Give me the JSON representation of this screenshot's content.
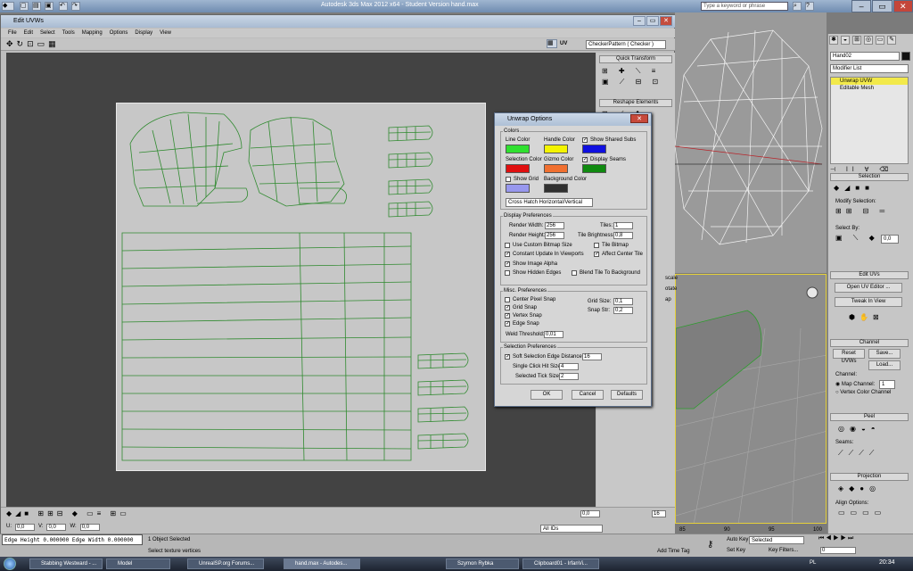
{
  "app": {
    "title": "Autodesk 3ds Max  2012 x64  -  Student Version   hand.max",
    "search_placeholder": "Type a keyword or phrase",
    "colors": {
      "uv_wire": "#2f8a2f",
      "titlebar": "#7f9cc0",
      "dialog_bg": "#d6d6d6",
      "accent_yellow": "#e5d03a"
    }
  },
  "uvw_window": {
    "title": "Edit UVWs",
    "menu": [
      "File",
      "Edit",
      "Select",
      "Tools",
      "Mapping",
      "Options",
      "Display",
      "View"
    ],
    "uv_label": "UV",
    "texture_dropdown": "CheckerPattern  ( Checker )",
    "quick_transform": "Quick Transform",
    "reshape_elements": "Reshape Elements",
    "side_fragments": [
      "scale",
      "otate",
      "ap"
    ],
    "bottom": {
      "u_label": "U:",
      "u_value": "0,0",
      "v_label": "V:",
      "v_value": "0,0",
      "w_label": "W:",
      "w_value": "0,0",
      "zoom_value": "0,0",
      "snap_value": "16",
      "ids_select": "All IDs"
    }
  },
  "dialog": {
    "title": "Unwrap Options",
    "colors_group": "Colors",
    "line_color": "Line Color",
    "line_color_hex": "#2fe02f",
    "handle_color": "Handle Color",
    "handle_color_hex": "#f4f400",
    "show_shared_subs": "Show Shared Subs",
    "shared_hex": "#1010e0",
    "selection_color": "Selection Color",
    "selection_hex": "#e01010",
    "gizmo_color": "Gizmo Color",
    "gizmo_hex": "#f07030",
    "display_seams": "Display Seams",
    "seams_hex": "#108a10",
    "show_grid": "Show Grid",
    "grid_hex": "#9898ee",
    "background_color": "Background Color",
    "background_hex": "#303030",
    "fill_mode": "Cross Hatch Horizontal/Vertical",
    "display_prefs": "Display Preferences",
    "render_width": "Render Width:",
    "render_width_val": "256",
    "render_height": "Render Height:",
    "render_height_val": "256",
    "tiles": "Tiles:",
    "tiles_val": "1",
    "tile_brightness": "Tile Brightness:",
    "tile_brightness_val": "0,8",
    "use_custom_bitmap": "Use Custom Bitmap Size",
    "tile_bitmap": "Tile Bitmap",
    "constant_update": "Constant Update In Viewports",
    "affect_center_tile": "Affect Center Tile",
    "show_image_alpha": "Show Image Alpha",
    "show_hidden_edges": "Show Hidden Edges",
    "blend_tile": "Blend Tile To Background",
    "misc_prefs": "Misc. Preferences",
    "center_pixel_snap": "Center Pixel Snap",
    "grid_size": "Grid Size:",
    "grid_size_val": "0,1",
    "grid_snap": "Grid Snap",
    "snap_str": "Snap Str:",
    "snap_str_val": "0,2",
    "vertex_snap": "Vertex Snap",
    "edge_snap": "Edge Snap",
    "weld_threshold": "Weld Threshold:",
    "weld_threshold_val": "0,01",
    "selection_prefs": "Selection Preferences",
    "soft_selection": "Soft Selection Edge Distance",
    "soft_selection_val": "16",
    "single_click": "Single Click Hit Size",
    "single_click_val": "4",
    "selected_tick": "Selected Tick Size",
    "selected_tick_val": "2",
    "ok": "OK",
    "cancel": "Cancel",
    "defaults": "Defaults"
  },
  "command_panel": {
    "object_name": "Hand02",
    "modifier_list": "Modifier List",
    "stack": [
      "Unwrap UVW",
      "Editable Mesh"
    ],
    "selection": "Selection",
    "modify_selection": "Modify Selection:",
    "select_by": "Select By:",
    "select_val": "0,0",
    "edit_uvs": "Edit UVs",
    "open_uv_editor": "Open UV Editor ...",
    "tweak_in_view": "Tweak In View",
    "channel": "Channel",
    "reset_uvws": "Reset UVWs",
    "save": "Save...",
    "load": "Load...",
    "channel_label": "Channel:",
    "map_channel": "Map Channel:",
    "map_channel_val": "1",
    "vertex_color_channel": "Vertex Color Channel",
    "peel": "Peel",
    "seams": "Seams:",
    "projection": "Projection",
    "align_options": "Align Options:"
  },
  "status": {
    "edge_readout": "Edge Height 0.000000 Edge Width 0.000000",
    "selection": "1 Object Selected",
    "prompt": "Select texture vertices",
    "add_time_tag": "Add Time Tag",
    "auto_key": "Auto Key",
    "set_key": "Set Key",
    "selected": "Selected",
    "key_filters": "Key Filters...",
    "ruler": [
      "85",
      "90",
      "95",
      "100"
    ],
    "frame": "0"
  },
  "taskbar": {
    "tasks": [
      "Stabbing Westward - ...",
      "Model",
      "UnrealSP.org Forums...",
      "hand.max - Autodes...",
      "Szymon Rybka",
      "Clipboard01 - IrfanVi..."
    ],
    "lang": "PL",
    "clock": "20:34"
  }
}
